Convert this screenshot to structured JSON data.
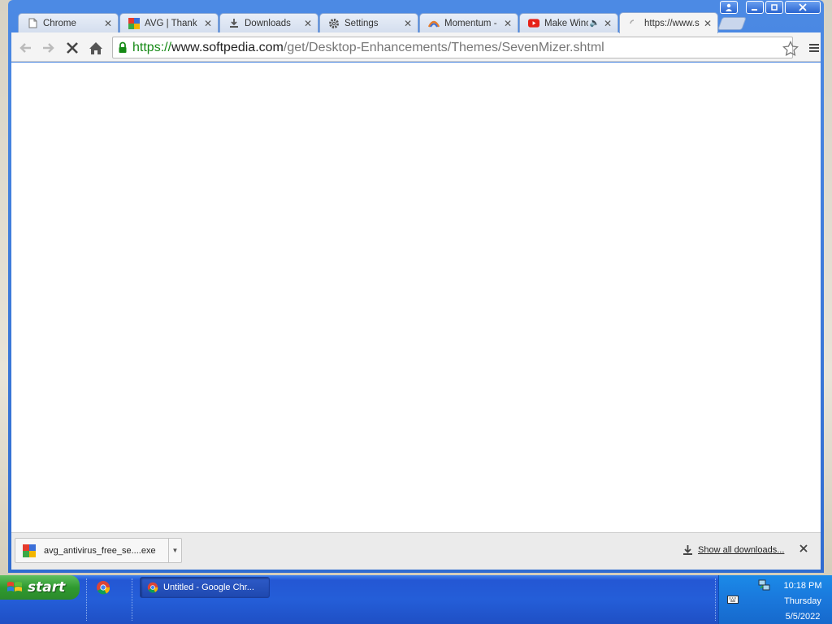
{
  "browser": {
    "tabs": [
      {
        "label": "Chrome",
        "icon": "page-icon"
      },
      {
        "label": "AVG | Thank y",
        "icon": "avg-icon"
      },
      {
        "label": "Downloads",
        "icon": "download-icon"
      },
      {
        "label": "Settings",
        "icon": "gear-icon"
      },
      {
        "label": "Momentum - C",
        "icon": "momentum-icon"
      },
      {
        "label": "Make Winc",
        "icon": "youtube-icon"
      },
      {
        "label": "https://www.s",
        "icon": "loading-icon"
      }
    ],
    "url": {
      "scheme": "https://",
      "host": "www.softpedia.com",
      "path": "/get/Desktop-Enhancements/Themes/SevenMizer.shtml"
    }
  },
  "download_shelf": {
    "file_name": "avg_antivirus_free_se....exe",
    "show_all_label": "Show all downloads..."
  },
  "taskbar": {
    "start_label": "start",
    "task_label": "Untitled - Google Chr...",
    "clock": {
      "time": "10:18 PM",
      "day": "Thursday",
      "date": "5/5/2022"
    }
  },
  "colors": {
    "xp_blue": "#245ed8",
    "start_green": "#2f9a2f",
    "secure_green": "#168a16"
  }
}
